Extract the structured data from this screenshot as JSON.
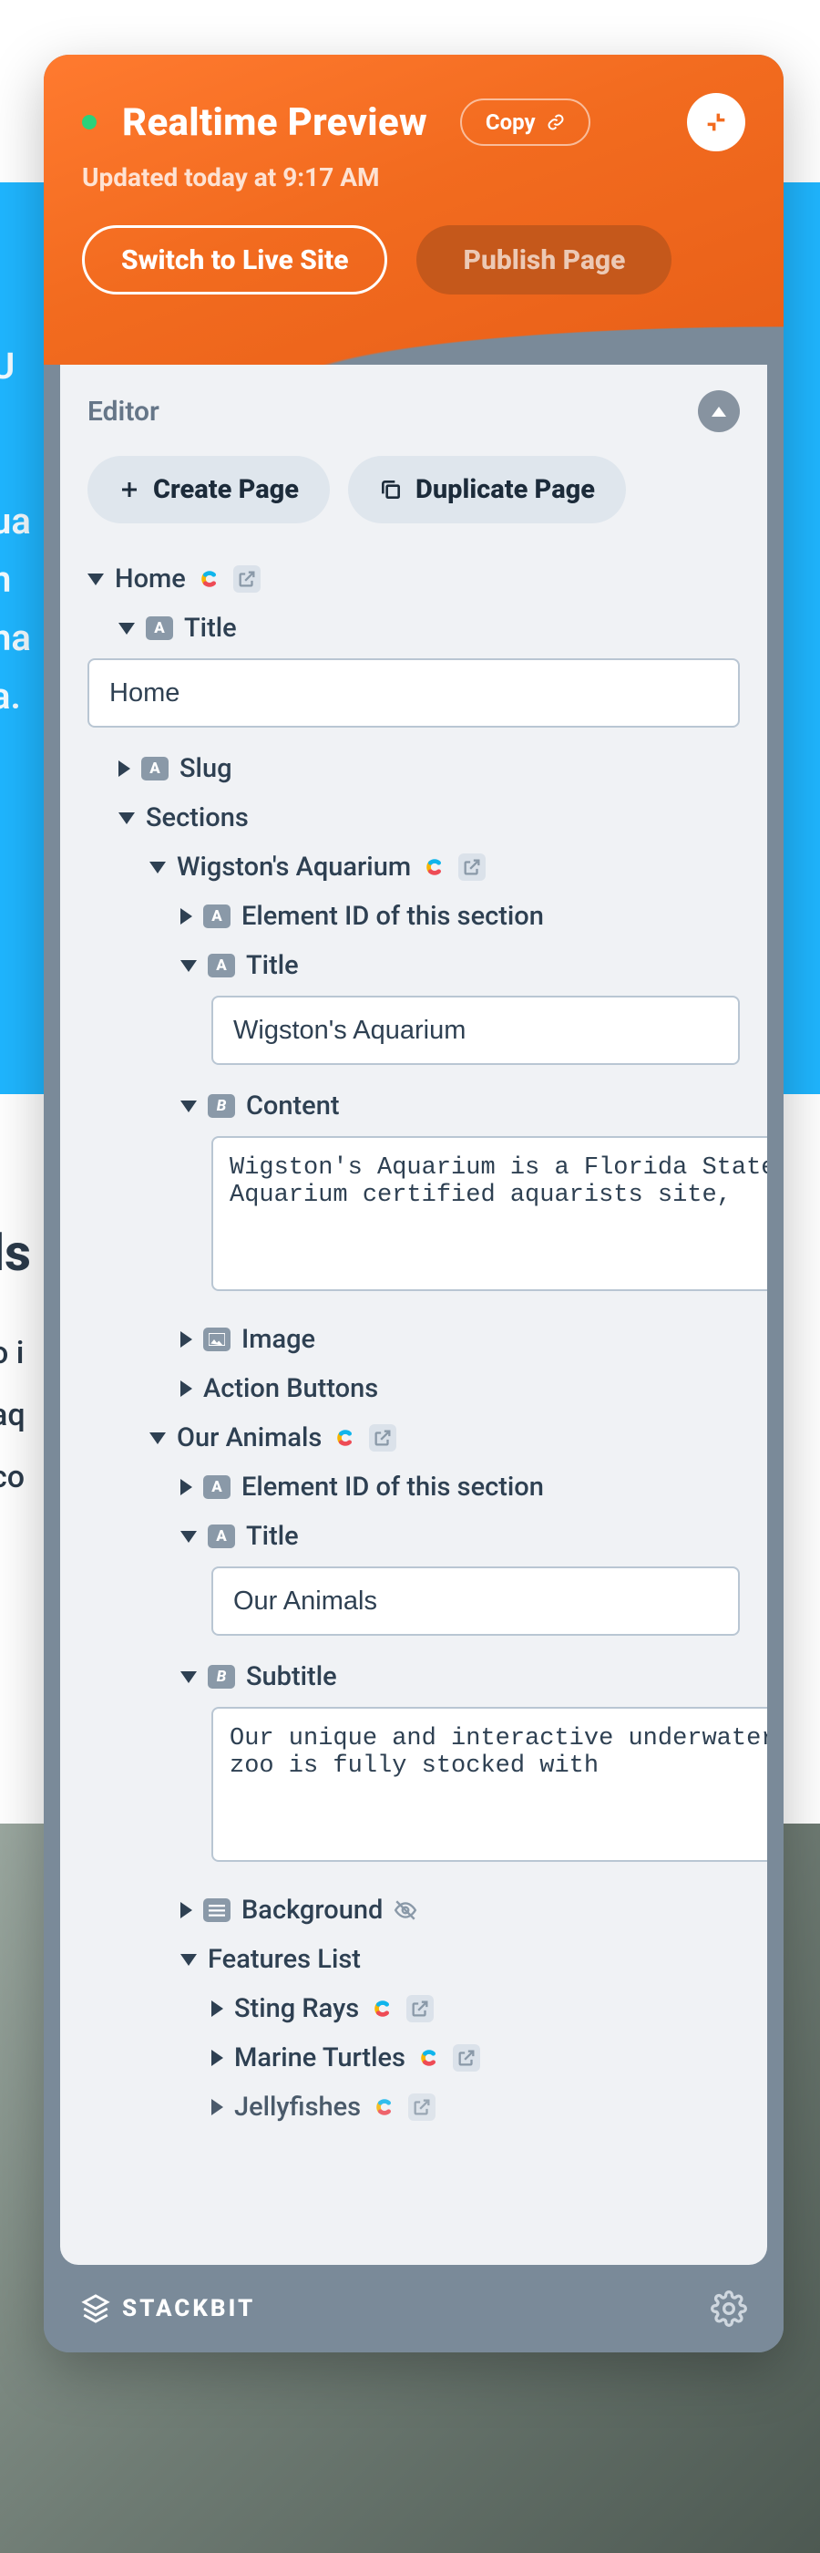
{
  "header": {
    "title": "Realtime Preview",
    "copy_label": "Copy",
    "updated_text": "Updated today at 9:17 AM",
    "switch_label": "Switch to Live Site",
    "publish_label": "Publish Page"
  },
  "editor": {
    "heading": "Editor",
    "create_page_label": "Create Page",
    "duplicate_page_label": "Duplicate Page"
  },
  "tree": {
    "home": {
      "label": "Home",
      "title_field_label": "Title",
      "title_value": "Home",
      "slug_label": "Slug",
      "sections_label": "Sections",
      "sections": {
        "wigstons": {
          "label": "Wigston's Aquarium",
          "element_id_label": "Element ID of this section",
          "title_field_label": "Title",
          "title_value": "Wigston's Aquarium",
          "content_label": "Content",
          "content_value": "Wigston's Aquarium is a Florida State Aquarium certified aquarists site,",
          "image_label": "Image",
          "action_buttons_label": "Action Buttons"
        },
        "our_animals": {
          "label": "Our Animals",
          "element_id_label": "Element ID of this section",
          "title_field_label": "Title",
          "title_value": "Our Animals",
          "subtitle_label": "Subtitle",
          "subtitle_value": "Our unique and interactive underwater zoo is fully stocked with",
          "background_label": "Background",
          "features_list_label": "Features List",
          "features": {
            "sting_rays": "Sting Rays",
            "marine_turtles": "Marine Turtles",
            "jellyfishes": "Jellyfishes"
          }
        }
      }
    }
  },
  "footer": {
    "brand": "STACKBIT"
  },
  "colors": {
    "orange": "#f26b1f",
    "panel_gray": "#7a8a99",
    "body_bg": "#f0f2f5",
    "text": "#2e4052"
  }
}
